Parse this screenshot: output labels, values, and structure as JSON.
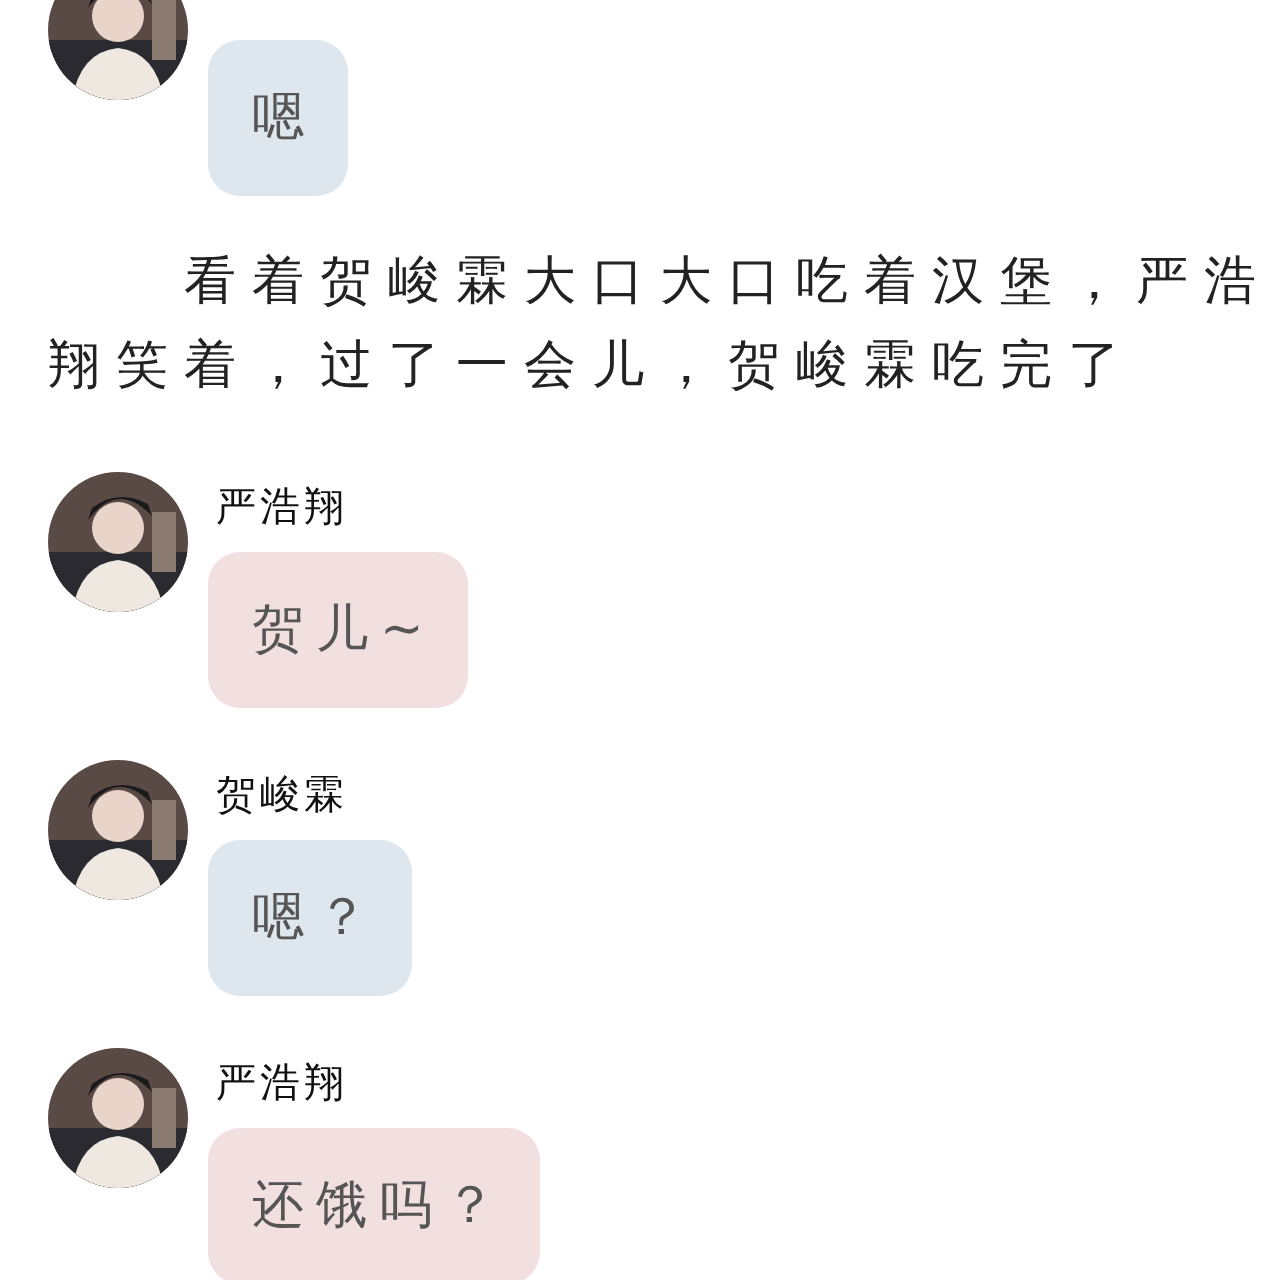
{
  "feed": [
    {
      "kind": "message",
      "text": "嗯",
      "color": "#dee6ee"
    },
    {
      "kind": "narration",
      "text": "看着贺峻霖大口大口吃着汉堡，严浩翔笑着，过了一会儿，贺峻霖吃完了"
    },
    {
      "kind": "message",
      "sender": "严浩翔",
      "text": "贺儿~",
      "color": "#f2e0e0"
    },
    {
      "kind": "message",
      "sender": "贺峻霖",
      "text": "嗯？",
      "color": "#dee6ee"
    },
    {
      "kind": "message",
      "sender": "严浩翔",
      "text": "还饿吗？",
      "color": "#f2e0e0"
    }
  ]
}
